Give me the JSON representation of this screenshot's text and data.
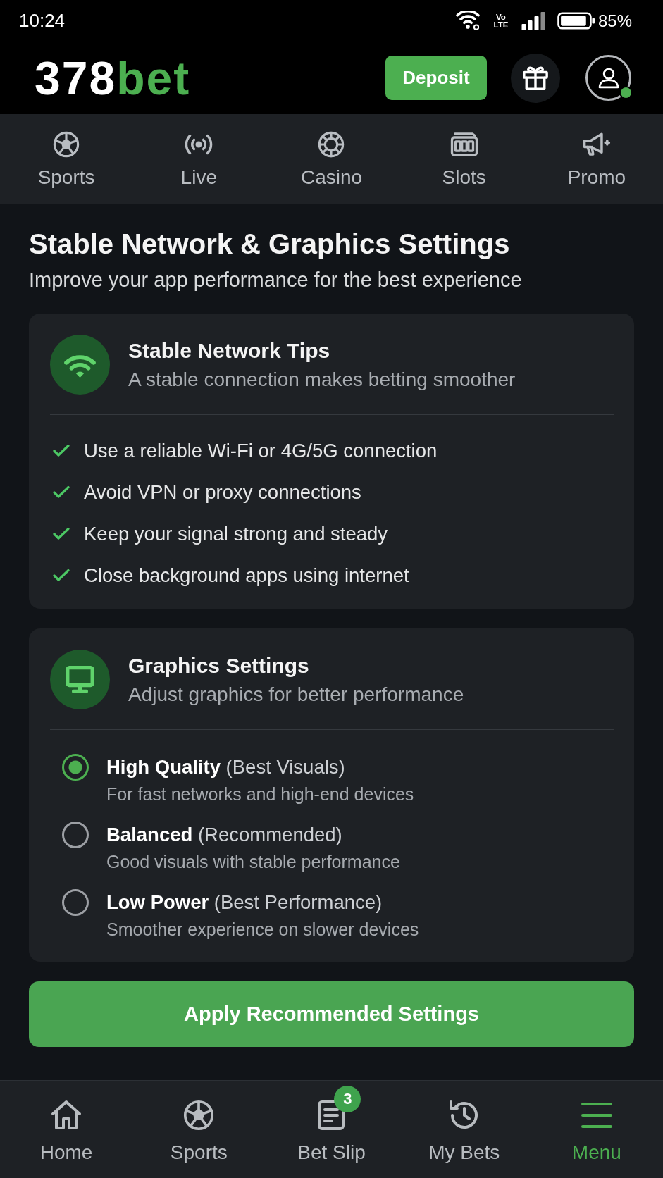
{
  "status_bar": {
    "time": "10:24",
    "network_type": "Vo LTE",
    "battery": "85%"
  },
  "header": {
    "logo": {
      "text": "378",
      "accent": "bet"
    },
    "deposit_button": "Deposit",
    "profile": {
      "online": true
    }
  },
  "nav_tabs": [
    {
      "label": "Sports",
      "selected": false
    },
    {
      "label": "Live",
      "selected": false
    },
    {
      "label": "Casino",
      "selected": false
    },
    {
      "label": "Slots",
      "selected": false
    },
    {
      "label": "Promo",
      "selected": false
    }
  ],
  "page": {
    "title": "Stable Network & Graphics Settings",
    "subtitle": "Improve your app performance for the best experience"
  },
  "network_card": {
    "title": "Stable Network Tips",
    "subtitle": "A stable connection makes betting smoother",
    "tips": [
      "Use a reliable Wi-Fi or 4G/5G connection",
      "Avoid VPN or proxy connections",
      "Keep your signal strong and steady",
      "Close background apps using internet"
    ]
  },
  "graphics_card": {
    "title": "Graphics Settings",
    "subtitle": "Adjust graphics for better performance",
    "options": [
      {
        "label": "**High Quality** (Best Visuals)",
        "description": "For fast networks and high-end devices",
        "selected": true
      },
      {
        "label": "**Balanced** (Recommended)",
        "description": "Good visuals with stable performance",
        "selected": false
      },
      {
        "label": "**Low Power** (Best Performance)",
        "description": "Smoother experience on slower devices",
        "selected": false
      }
    ]
  },
  "apply_button": "Apply Recommended Settings",
  "bottom_nav": [
    {
      "label": "Home",
      "selected": false
    },
    {
      "label": "Sports",
      "selected": false
    },
    {
      "label": "Bet Slip",
      "selected": false,
      "badge": "3"
    },
    {
      "label": "My Bets",
      "selected": false
    },
    {
      "label": "Menu",
      "selected": true
    }
  ]
}
